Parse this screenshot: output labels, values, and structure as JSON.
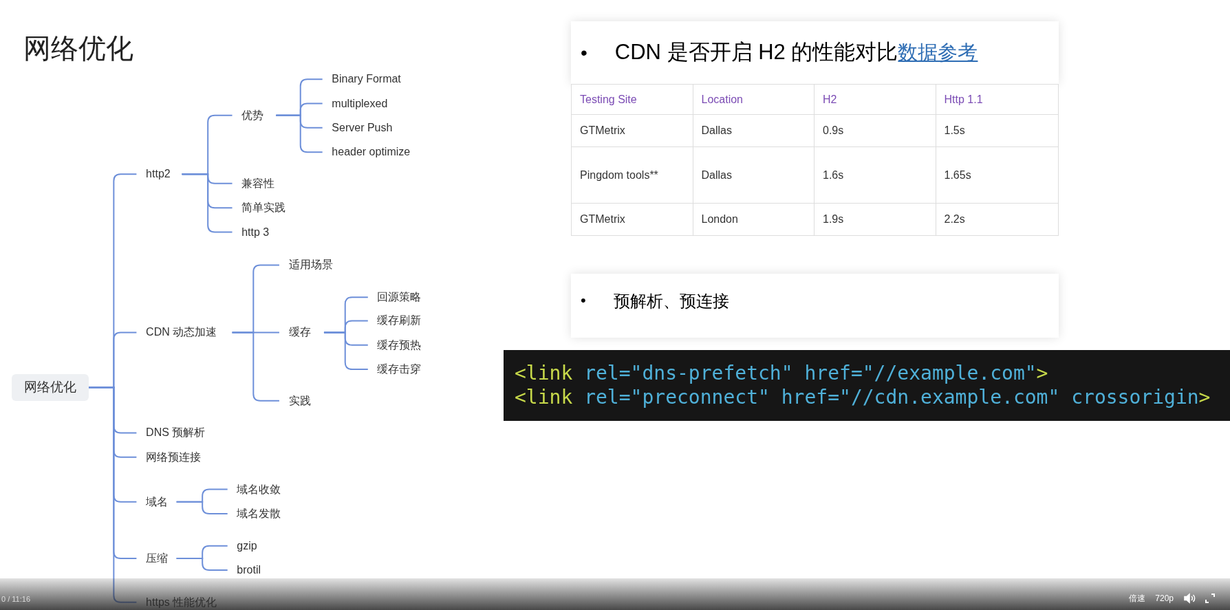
{
  "slide": {
    "title": "网络优化",
    "mindmap": {
      "label": "网络优化",
      "children": [
        {
          "label": "http2",
          "children": [
            {
              "label": "优势",
              "children": [
                {
                  "label": "Binary Format"
                },
                {
                  "label": "multiplexed"
                },
                {
                  "label": "Server Push"
                },
                {
                  "label": "header optimize"
                }
              ]
            },
            {
              "label": "兼容性"
            },
            {
              "label": "简单实践"
            },
            {
              "label": "http 3"
            }
          ]
        },
        {
          "label": "CDN 动态加速",
          "children": [
            {
              "label": "适用场景"
            },
            {
              "label": "缓存",
              "children": [
                {
                  "label": "回源策略"
                },
                {
                  "label": "缓存刷新"
                },
                {
                  "label": "缓存预热"
                },
                {
                  "label": "缓存击穿"
                }
              ]
            },
            {
              "label": "实践"
            }
          ]
        },
        {
          "label": "DNS 预解析"
        },
        {
          "label": "网络预连接"
        },
        {
          "label": "域名",
          "children": [
            {
              "label": "域名收敛"
            },
            {
              "label": "域名发散"
            }
          ]
        },
        {
          "label": "压缩",
          "children": [
            {
              "label": "gzip"
            },
            {
              "label": "brotil"
            }
          ]
        },
        {
          "label": "https 性能优化"
        }
      ]
    },
    "cards": [
      {
        "bullet": "•",
        "text": "CDN 是否开启 H2 的性能对比",
        "link": "数据参考"
      },
      {
        "bullet": "•",
        "text": "预解析、预连接"
      }
    ],
    "table": {
      "columns": [
        "Testing Site",
        "Location",
        "H2",
        "Http 1.1"
      ],
      "rows": [
        [
          "GTMetrix",
          "Dallas",
          "0.9s",
          "1.5s"
        ],
        [
          "Pingdom tools**",
          "Dallas",
          "1.6s",
          "1.65s"
        ],
        [
          "GTMetrix",
          "London",
          "1.9s",
          "2.2s"
        ]
      ]
    },
    "code": [
      [
        {
          "kind": "tag",
          "text": "<link"
        },
        {
          "kind": "attr",
          "text": " rel=\"dns-prefetch\" href=\"//example.com\""
        },
        {
          "kind": "tag",
          "text": ">"
        }
      ],
      [
        {
          "kind": "tag",
          "text": "<link"
        },
        {
          "kind": "attr",
          "text": " rel=\"preconnect\" href=\"//cdn.example.com\" crossorigin"
        },
        {
          "kind": "tag",
          "text": ">"
        }
      ]
    ]
  },
  "player": {
    "time": "0 / 11:16",
    "speed": "倍速",
    "quality": "720p"
  }
}
